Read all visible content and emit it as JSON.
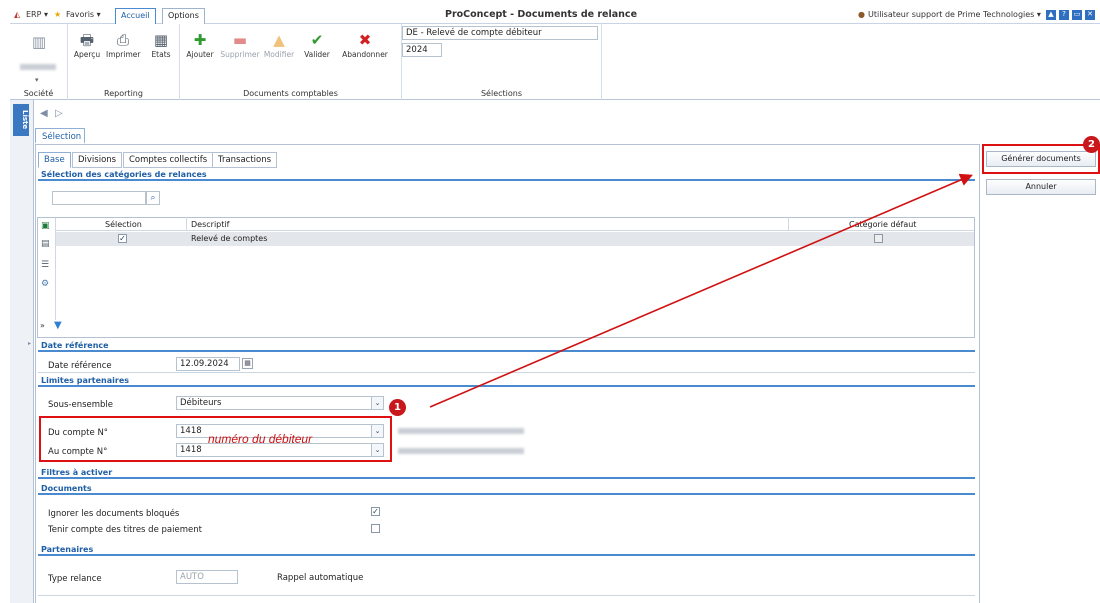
{
  "titlebar": {
    "erp": "ERP ▾",
    "favoris": "Favoris ▾",
    "tab_accueil": "Accueil",
    "tab_options": "Options",
    "title": "ProConcept - Documents de relance",
    "user": "Utilisateur support de Prime Technologies ▾"
  },
  "ribbon": {
    "societe_label": "Société",
    "societe_name": "",
    "apercu": "Aperçu",
    "imprimer": "Imprimer",
    "etats": "Etats",
    "reporting_label": "Reporting",
    "ajouter": "Ajouter",
    "supprimer": "Supprimer",
    "modifier": "Modifier",
    "valider": "Valider",
    "abandonner": "Abandonner",
    "docs_label": "Documents comptables",
    "selection_doc": "DE - Relevé de compte débiteur",
    "selection_year": "2024",
    "selections_label": "Sélections"
  },
  "left": {
    "vtab": "Liste"
  },
  "main": {
    "tab_selection": "Sélection",
    "subtabs": [
      "Base",
      "Divisions",
      "Comptes collectifs",
      "Transactions"
    ],
    "categories_title": "Sélection des catégories de relances",
    "grid": {
      "headers": [
        "Sélection",
        "Descriptif",
        "Catégorie défaut"
      ],
      "rows": [
        {
          "desc": "Relevé de comptes",
          "selected": true,
          "default": false
        }
      ]
    },
    "date_section": "Date référence",
    "date_label": "Date référence",
    "date_value": "12.09.2024",
    "limites_section": "Limites partenaires",
    "sous_ensemble_label": "Sous-ensemble",
    "sous_ensemble_value": "Débiteurs",
    "du_compte_label": "Du compte N°",
    "du_compte_value": "1418",
    "au_compte_label": "Au compte N°",
    "au_compte_value": "1418",
    "annotation": "numéro du débiteur",
    "filtres_section": "Filtres à activer",
    "documents_section": "Documents",
    "ignorer_label": "Ignorer les documents bloqués",
    "ignorer_checked": true,
    "titres_label": "Tenir compte des titres de paiement",
    "titres_checked": false,
    "partenaires_section": "Partenaires",
    "type_relance_label": "Type relance",
    "type_relance_value": "AUTO",
    "type_relance_desc": "Rappel automatique"
  },
  "actions": {
    "generer": "Générer documents",
    "annuler": "Annuler"
  },
  "badges": {
    "one": "1",
    "two": "2"
  },
  "colors": {
    "accent": "#1f5fa6",
    "annotation_red": "#d11111"
  }
}
